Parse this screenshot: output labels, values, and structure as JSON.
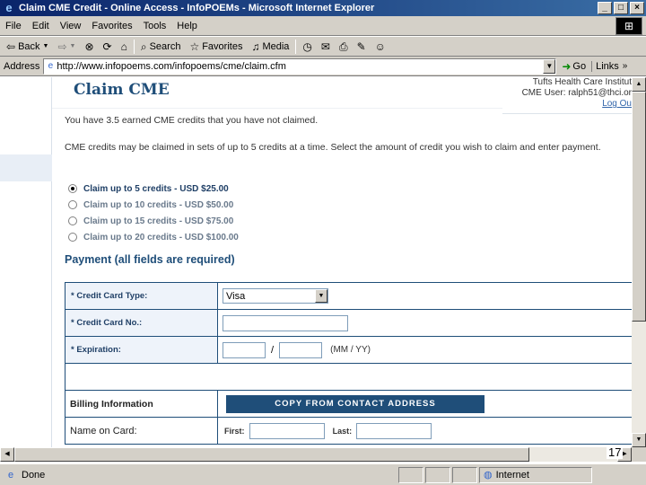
{
  "window": {
    "title": "Claim CME Credit - Online Access - InfoPOEMs - Microsoft Internet Explorer",
    "buttons": {
      "minimize": "_",
      "maximize": "□",
      "close": "×"
    }
  },
  "menu": {
    "items": [
      "File",
      "Edit",
      "View",
      "Favorites",
      "Tools",
      "Help"
    ]
  },
  "toolbar": {
    "back": "Back",
    "search": "Search",
    "favorites": "Favorites",
    "media": "Media"
  },
  "address": {
    "label": "Address",
    "url": "http://www.infopoems.com/infopoems/cme/claim.cfm",
    "go": "Go",
    "links": "Links"
  },
  "page": {
    "heading": "Claim CME",
    "institution": "Tufts Health Care Institut",
    "cme_user": "CME User: ralph51@thci.or",
    "logout": "Log Ou",
    "unclaimed_msg": "You have 3.5 earned CME credits that you have not claimed.",
    "instructions": "CME credits may be claimed in sets of up to 5 credits at a time. Select the amount of credit you wish to claim and enter payment.",
    "options": [
      {
        "label": "Claim up to 5 credits - USD $25.00",
        "selected": true
      },
      {
        "label": "Claim up to 10 credits - USD $50.00",
        "selected": false
      },
      {
        "label": "Claim up to 15 credits - USD $75.00",
        "selected": false
      },
      {
        "label": "Claim up to 20 credits - USD $100.00",
        "selected": false
      }
    ],
    "payment_heading": "Payment (all fields are required)",
    "form": {
      "card_type_label": "* Credit Card Type:",
      "card_type_value": "Visa",
      "card_no_label": "* Credit Card No.:",
      "card_no_value": "",
      "expiration_label": "* Expiration:",
      "exp_month": "",
      "exp_year": "",
      "exp_slash": "/",
      "exp_hint": "(MM / YY)",
      "billing_label": "Billing Information",
      "copy_button": "COPY FROM CONTACT ADDRESS",
      "name_label": "Name on Card:",
      "first_label": "First:",
      "first_value": "",
      "last_label": "Last:",
      "last_value": ""
    }
  },
  "status": {
    "text": "Done",
    "zone": "Internet"
  },
  "slide_number": "17"
}
